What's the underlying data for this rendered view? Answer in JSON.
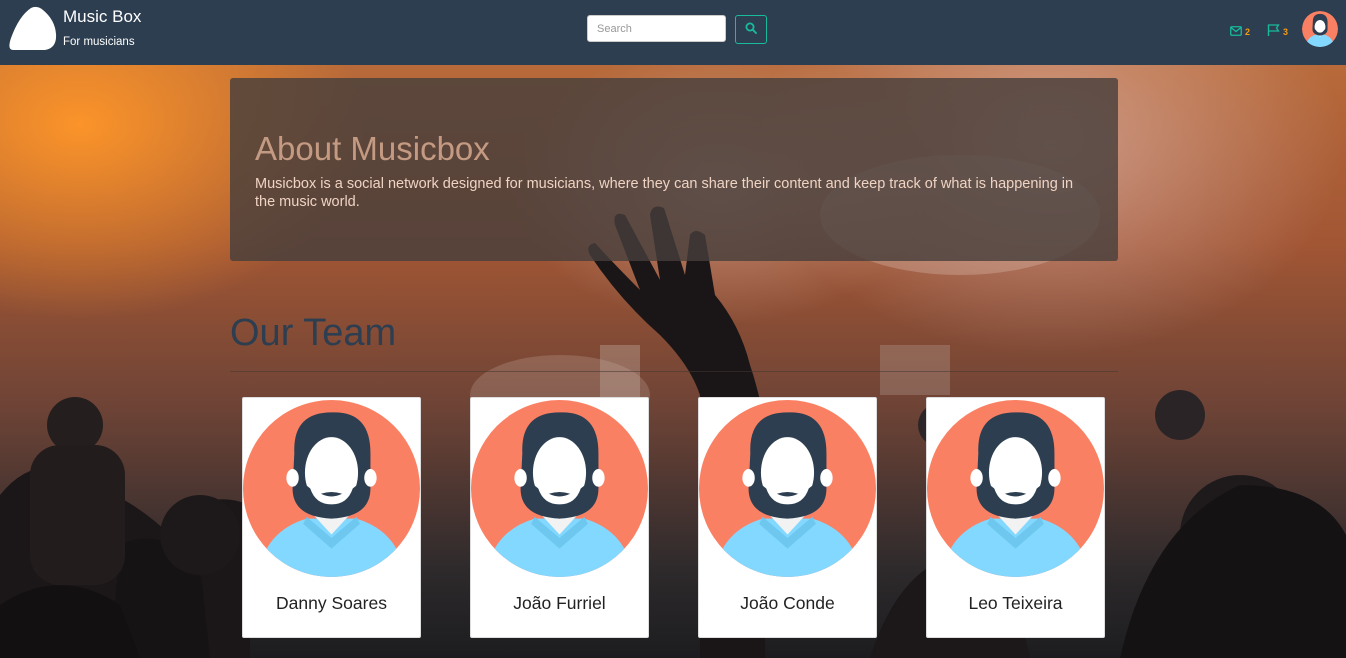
{
  "brand": {
    "title": "Music Box",
    "subtitle": "For musicians"
  },
  "search": {
    "placeholder": "Search",
    "button_icon": "search-icon"
  },
  "notifications": {
    "messages": {
      "icon": "envelope-icon",
      "count": "2"
    },
    "flags": {
      "icon": "flag-icon",
      "count": "3"
    }
  },
  "about": {
    "title": "About Musicbox",
    "text": "Musicbox is a social network designed for musicians, where they can share their content and keep track of what is happening in the music world."
  },
  "team": {
    "heading": "Our Team",
    "members": [
      {
        "name": "Danny Soares"
      },
      {
        "name": "João Furriel"
      },
      {
        "name": "João Conde"
      },
      {
        "name": "Leo Teixeira"
      }
    ]
  },
  "colors": {
    "navbar": "#2c3e50",
    "accent": "#18bc9c",
    "badge": "#f39c12",
    "avatar_bg": "#fa8064",
    "avatar_shirt": "#82d8ff"
  }
}
